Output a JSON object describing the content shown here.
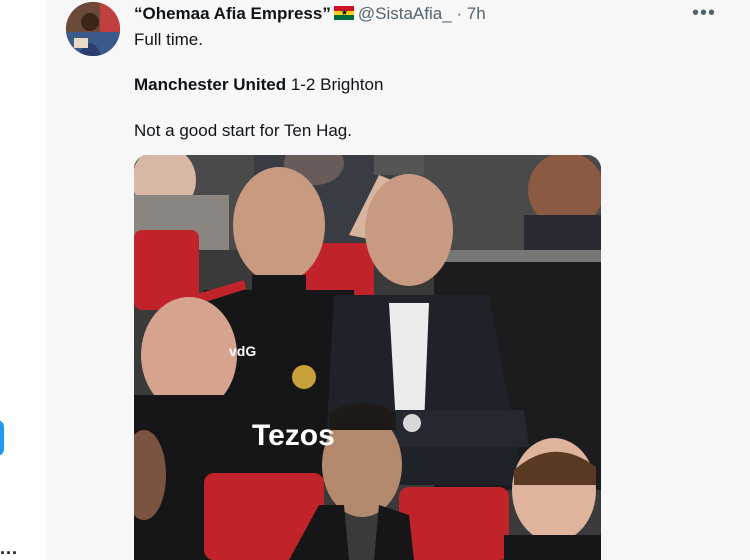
{
  "tweet": {
    "author_name": "“Ohemaa Afia Empress”",
    "flag_icon": "ghana-flag-icon",
    "handle": "@SistaAfia_",
    "separator": "·",
    "time": "7h",
    "more_label": "•••",
    "line1": "Full time.",
    "score_team_home": "Manchester United",
    "score_rest": " 1-2 Brighton",
    "line3": "Not a good start for Ten Hag.",
    "media_description": "photo-of-manager-and-players-in-dugout",
    "media_texts": {
      "jersey_initials": "vdG",
      "sponsor": "Tezos"
    }
  },
  "left_gutter": {
    "dots": "..."
  },
  "colors": {
    "accent": "#1d9bf0",
    "text": "#0f1419",
    "secondary_text": "#536471",
    "background": "#f7f7f7"
  }
}
